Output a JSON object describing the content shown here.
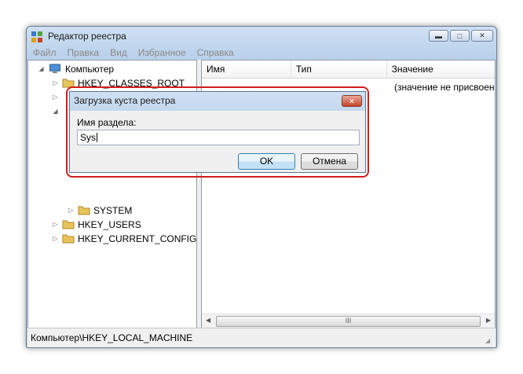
{
  "window": {
    "title": "Редактор реестра",
    "icon": "regedit-icon"
  },
  "caption_buttons": {
    "minimize": "▬",
    "maximize": "□",
    "close": "✕"
  },
  "menu": [
    "Файл",
    "Правка",
    "Вид",
    "Избранное",
    "Справка"
  ],
  "tree": {
    "root": "Компьютер",
    "items": [
      {
        "label": "HKEY_CLASSES_ROOT"
      },
      {
        "label": "SYSTEM"
      },
      {
        "label": "HKEY_USERS"
      },
      {
        "label": "HKEY_CURRENT_CONFIG"
      }
    ]
  },
  "list": {
    "columns": [
      "Имя",
      "Тип",
      "Значение"
    ],
    "rows": [
      {
        "value": "(значение не присвоено)"
      }
    ]
  },
  "scrollbar": {
    "thumb_grip": "III"
  },
  "status": {
    "path": "Компьютер\\HKEY_LOCAL_MACHINE"
  },
  "dialog": {
    "title": "Загрузка куста реестра",
    "label": "Имя раздела:",
    "input_value": "Sys",
    "ok": "OK",
    "cancel": "Отмена",
    "close": "✕"
  },
  "colors": {
    "highlight_frame": "#d21d1d",
    "ok_border": "#3c7fb1"
  }
}
